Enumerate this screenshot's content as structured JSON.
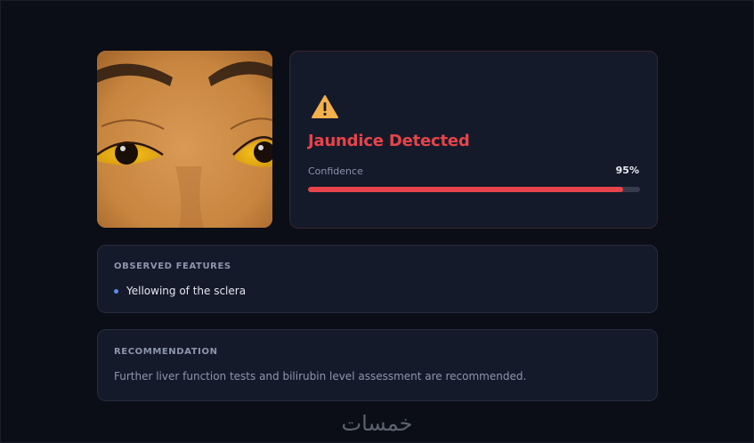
{
  "result": {
    "icon": "warning-triangle-icon",
    "title": "Jaundice Detected",
    "confidence_label": "Confidence",
    "confidence_text": "95%",
    "confidence_fraction": 0.95,
    "accent_color": "#e8434a"
  },
  "photo": {
    "subject": "eyes-photo"
  },
  "features": {
    "heading": "OBSERVED FEATURES",
    "items": [
      "Yellowing of the sclera"
    ]
  },
  "recommendation": {
    "heading": "RECOMMENDATION",
    "text": "Further liver function tests and bilirubin level assessment are recommended."
  },
  "watermark": "خمسات"
}
